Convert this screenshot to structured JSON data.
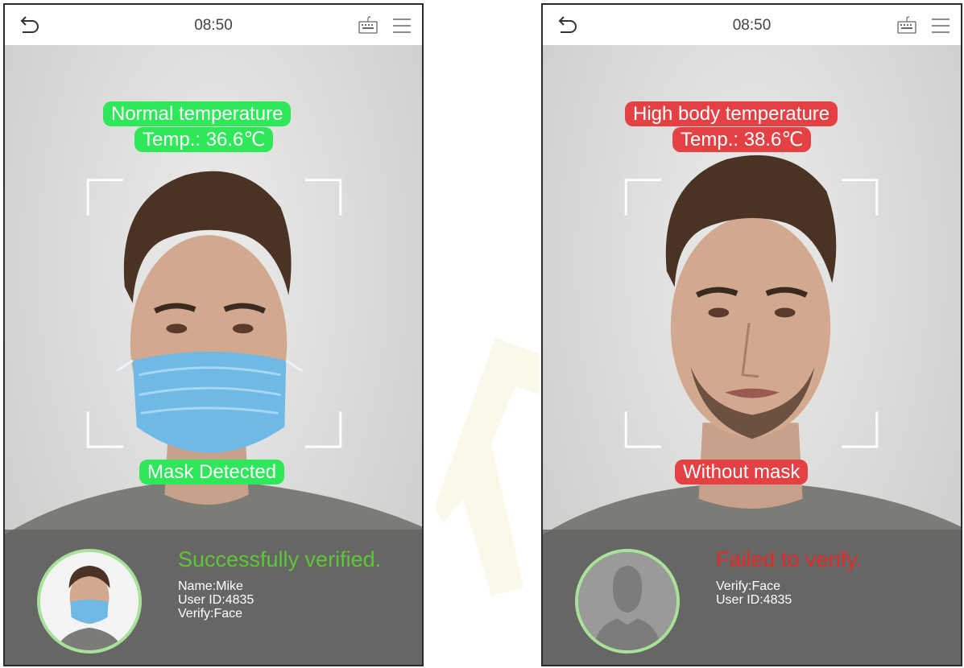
{
  "left_screen": {
    "clock": "08:50",
    "icons": {
      "back": "back-arrow-icon",
      "keyboard": "keyboard-icon",
      "menu": "menu-icon"
    },
    "status_label": "Normal temperature",
    "temperature": "Temp.: 36.6℃",
    "mask_label": "Mask Detected",
    "result_title": "Successfully verified.",
    "name": "Name:Mike",
    "user_id": "User ID:4835",
    "verify": "Verify:Face",
    "colors": {
      "status": "#2ee85a",
      "result_title": "#5ec638"
    }
  },
  "right_screen": {
    "clock": "08:50",
    "icons": {
      "back": "back-arrow-icon",
      "keyboard": "keyboard-icon",
      "menu": "menu-icon"
    },
    "status_label": "High body temperature",
    "temperature": "Temp.: 38.6℃",
    "mask_label": "Without mask",
    "result_title": "Failed to verify.",
    "verify": "Verify:Face",
    "user_id": "User ID:4835",
    "colors": {
      "status": "#e34144",
      "result_title": "#e52a2a"
    }
  }
}
